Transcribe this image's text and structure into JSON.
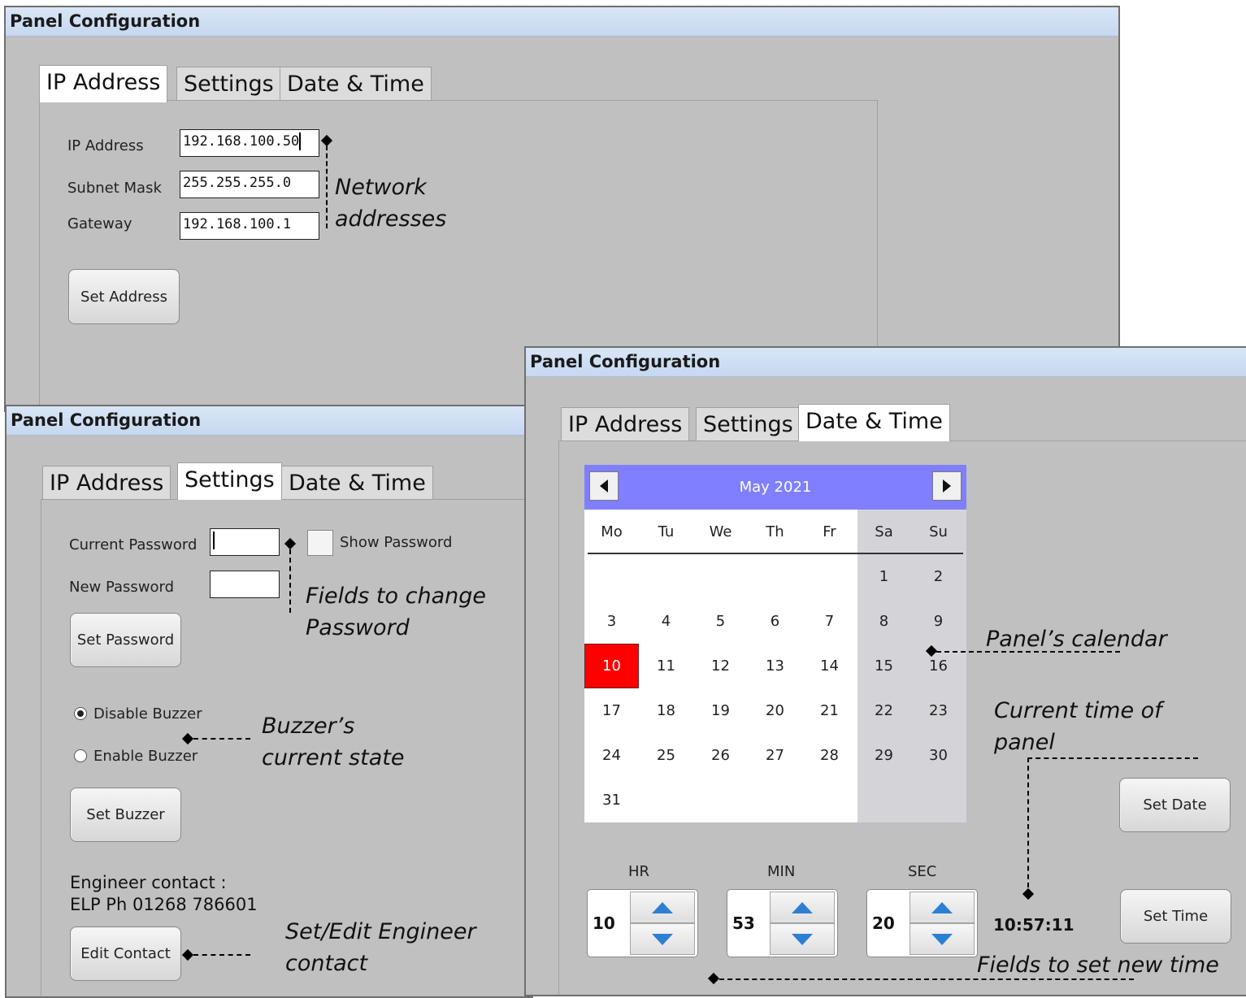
{
  "window_title": "Panel Configuration",
  "tabs": [
    "IP Address",
    "Settings",
    "Date & Time"
  ],
  "ip_window": {
    "fields": [
      {
        "label": "IP Address",
        "value": "192.168.100.50"
      },
      {
        "label": "Subnet Mask",
        "value": "255.255.255.0"
      },
      {
        "label": "Gateway",
        "value": "192.168.100.1"
      }
    ],
    "set_button": "Set Address"
  },
  "settings_window": {
    "current_password_label": "Current Password",
    "new_password_label": "New Password",
    "show_password_label": "Show Password",
    "set_password_button": "Set Password",
    "disable_buzzer_label": "Disable Buzzer",
    "enable_buzzer_label": "Enable Buzzer",
    "buzzer_selected": "Disable Buzzer",
    "set_buzzer_button": "Set Buzzer",
    "engineer_contact_label": "Engineer contact :",
    "engineer_contact_value": "ELP Ph 01268 786601",
    "edit_contact_button": "Edit Contact"
  },
  "datetime_window": {
    "calendar": {
      "month_label": "May 2021",
      "weekdays": [
        "Mo",
        "Tu",
        "We",
        "Th",
        "Fr",
        "Sa",
        "Su"
      ],
      "first_weekday_index": 5,
      "days_in_month": 31,
      "selected_day": 10
    },
    "set_date_button": "Set Date",
    "spinners": [
      {
        "label": "HR",
        "value": "10"
      },
      {
        "label": "MIN",
        "value": "53"
      },
      {
        "label": "SEC",
        "value": "20"
      }
    ],
    "current_time": "10:57:11",
    "set_time_button": "Set Time"
  },
  "annotations": {
    "network_addresses": [
      "Network",
      "addresses"
    ],
    "change_password": [
      "Fields to change",
      "Password"
    ],
    "buzzer_state": [
      "Buzzer’s",
      "current state"
    ],
    "engineer_contact": [
      "Set/Edit Engineer",
      "contact"
    ],
    "panel_calendar": "Panel’s calendar",
    "current_time": [
      "Current time of",
      "panel"
    ],
    "set_new_time": "Fields to set new time"
  }
}
